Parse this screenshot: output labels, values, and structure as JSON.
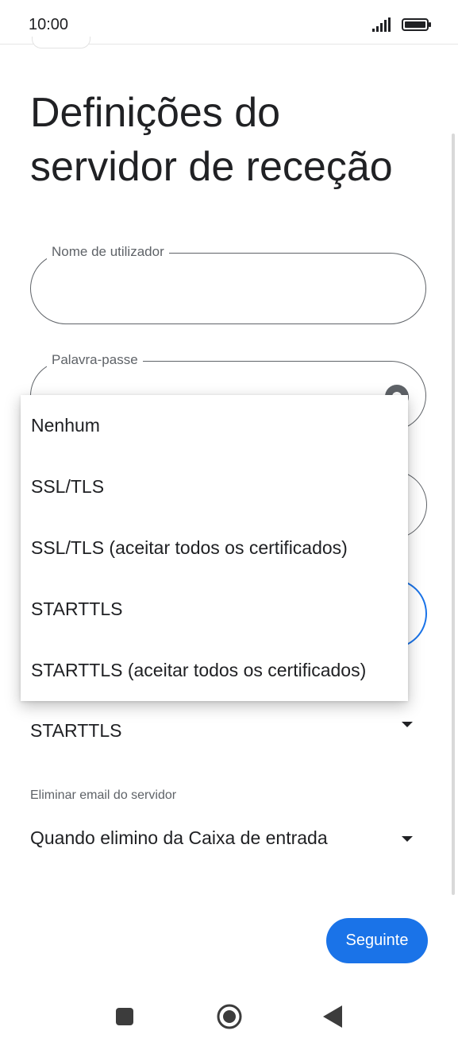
{
  "status_bar": {
    "time": "10:00"
  },
  "page_title": "Definições do servidor de receção",
  "username": {
    "label": "Nome de utilizador",
    "value": ""
  },
  "password": {
    "label": "Palavra-passe",
    "value": ""
  },
  "security": {
    "selected": "STARTTLS"
  },
  "delete_email": {
    "label": "Eliminar email do servidor",
    "selected": "Quando elimino da Caixa de entrada"
  },
  "next_button": "Seguinte",
  "security_menu": {
    "options": [
      "Nenhum",
      "SSL/TLS",
      "SSL/TLS (aceitar todos os certificados)",
      "STARTTLS",
      "STARTTLS (aceitar todos os certificados)"
    ]
  },
  "icons": {
    "signal": "signal-icon",
    "battery": "battery-icon",
    "visibility": "visibility-icon",
    "recents": "recents-icon",
    "home": "home-icon",
    "back": "back-icon"
  },
  "colors": {
    "accent": "#1a73e8",
    "text": "#202124",
    "secondary_text": "#5f6368"
  }
}
